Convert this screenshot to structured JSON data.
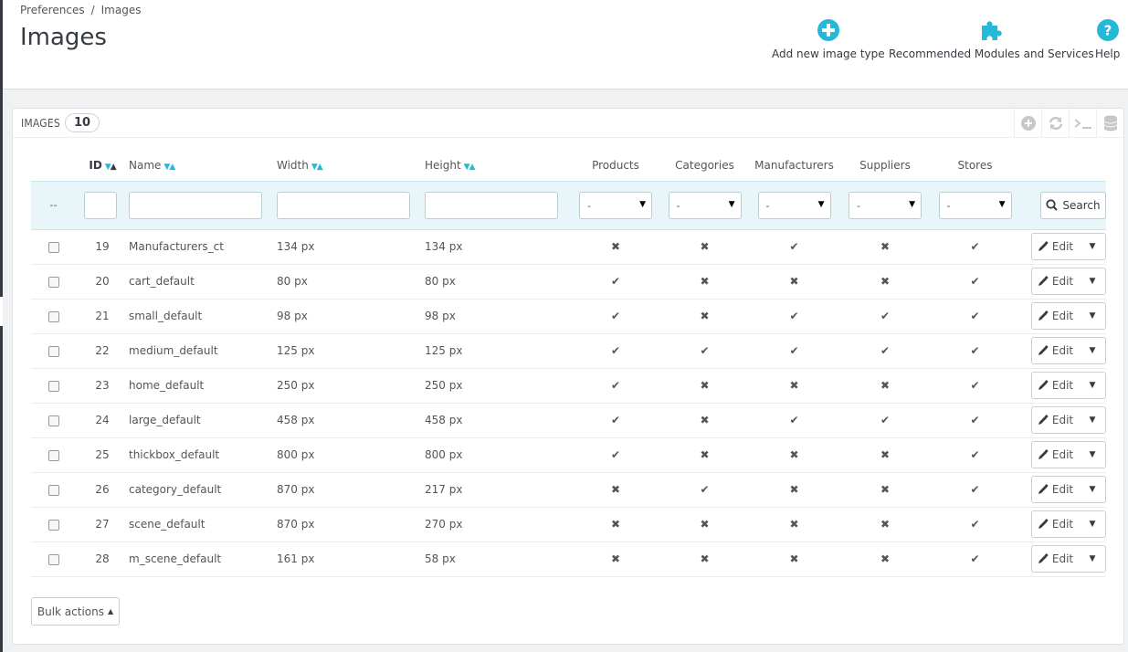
{
  "breadcrumb": {
    "parent": "Preferences",
    "separator": "/",
    "current": "Images"
  },
  "page_title": "Images",
  "toolbar": {
    "add_label": "Add new image type",
    "modules_label": "Recommended Modules and Services",
    "help_label": "Help"
  },
  "panel": {
    "title": "IMAGES",
    "count": "10"
  },
  "columns": {
    "id": "ID",
    "name": "Name",
    "width": "Width",
    "height": "Height",
    "products": "Products",
    "categories": "Categories",
    "manufacturers": "Manufacturers",
    "suppliers": "Suppliers",
    "stores": "Stores"
  },
  "filters": {
    "dashes": "--",
    "select_value": "-",
    "search_label": "Search"
  },
  "rows": [
    {
      "id": "19",
      "name": "Manufacturers_ct",
      "width": "134 px",
      "height": "134 px",
      "products": false,
      "categories": false,
      "manufacturers": true,
      "suppliers": false,
      "stores": true
    },
    {
      "id": "20",
      "name": "cart_default",
      "width": "80 px",
      "height": "80 px",
      "products": true,
      "categories": false,
      "manufacturers": false,
      "suppliers": false,
      "stores": true
    },
    {
      "id": "21",
      "name": "small_default",
      "width": "98 px",
      "height": "98 px",
      "products": true,
      "categories": false,
      "manufacturers": true,
      "suppliers": true,
      "stores": true
    },
    {
      "id": "22",
      "name": "medium_default",
      "width": "125 px",
      "height": "125 px",
      "products": true,
      "categories": true,
      "manufacturers": true,
      "suppliers": true,
      "stores": true
    },
    {
      "id": "23",
      "name": "home_default",
      "width": "250 px",
      "height": "250 px",
      "products": true,
      "categories": false,
      "manufacturers": false,
      "suppliers": false,
      "stores": true
    },
    {
      "id": "24",
      "name": "large_default",
      "width": "458 px",
      "height": "458 px",
      "products": true,
      "categories": false,
      "manufacturers": true,
      "suppliers": true,
      "stores": true
    },
    {
      "id": "25",
      "name": "thickbox_default",
      "width": "800 px",
      "height": "800 px",
      "products": true,
      "categories": false,
      "manufacturers": false,
      "suppliers": false,
      "stores": true
    },
    {
      "id": "26",
      "name": "category_default",
      "width": "870 px",
      "height": "217 px",
      "products": false,
      "categories": true,
      "manufacturers": false,
      "suppliers": false,
      "stores": true
    },
    {
      "id": "27",
      "name": "scene_default",
      "width": "870 px",
      "height": "270 px",
      "products": false,
      "categories": false,
      "manufacturers": false,
      "suppliers": false,
      "stores": true
    },
    {
      "id": "28",
      "name": "m_scene_default",
      "width": "161 px",
      "height": "58 px",
      "products": false,
      "categories": false,
      "manufacturers": false,
      "suppliers": false,
      "stores": true
    }
  ],
  "row_actions": {
    "edit_label": "Edit"
  },
  "bulk_actions_label": "Bulk actions",
  "colors": {
    "accent": "#25b9d7",
    "yes": "#72c279",
    "no": "#e08f95",
    "filter_bg": "#e8f5f9"
  }
}
